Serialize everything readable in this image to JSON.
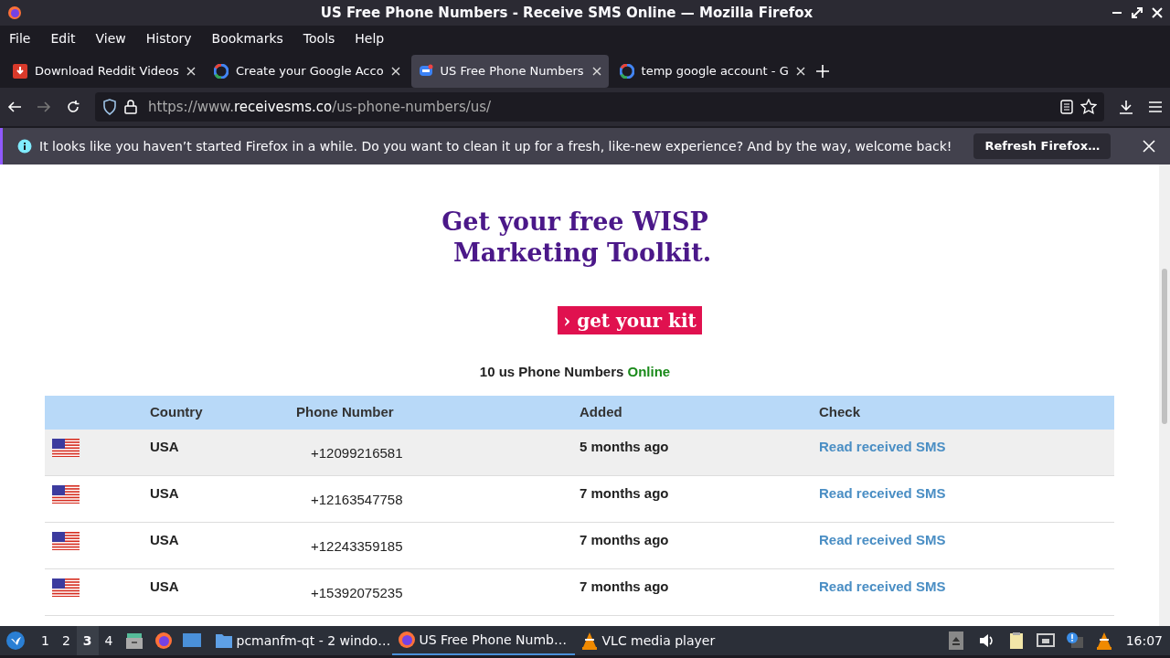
{
  "window": {
    "title": "US Free Phone Numbers - Receive SMS Online — Mozilla Firefox"
  },
  "menu": [
    "File",
    "Edit",
    "View",
    "History",
    "Bookmarks",
    "Tools",
    "Help"
  ],
  "tabs": [
    {
      "label": "Download Reddit Videos",
      "kind": "download",
      "selected": false
    },
    {
      "label": "Create your Google Acco",
      "kind": "google",
      "selected": false
    },
    {
      "label": "US Free Phone Numbers",
      "kind": "chat",
      "selected": true
    },
    {
      "label": "temp google account - G",
      "kind": "google",
      "selected": false
    }
  ],
  "address": {
    "prefix": "https://www.",
    "domain": "receivesms.co",
    "path": "/us-phone-numbers/us/"
  },
  "notification": {
    "message": "It looks like you haven’t started Firefox in a while. Do you want to clean it up for a fresh, like-new experience? And by the way, welcome back!",
    "button": "Refresh Firefox…"
  },
  "ad": {
    "heading_lines": [
      "Get your free WISP",
      "Marketing Toolkit."
    ],
    "button": "get your kit",
    "chevron": "›"
  },
  "summary": {
    "text": "10 us Phone Numbers",
    "status": "Online"
  },
  "table": {
    "columns": [
      "Country",
      "Phone Number",
      "Added",
      "Check"
    ],
    "rows": [
      {
        "country": "USA",
        "number": "+12099216581",
        "added": "5 months ago",
        "link": "Read received SMS",
        "highlighted": true
      },
      {
        "country": "USA",
        "number": "+12163547758",
        "added": "7 months ago",
        "link": "Read received SMS",
        "highlighted": false
      },
      {
        "country": "USA",
        "number": "+12243359185",
        "added": "7 months ago",
        "link": "Read received SMS",
        "highlighted": false
      },
      {
        "country": "USA",
        "number": "+15392075235",
        "added": "7 months ago",
        "link": "Read received SMS",
        "highlighted": false
      }
    ]
  },
  "taskbar": {
    "workspaces": [
      {
        "label": "1",
        "selected": false
      },
      {
        "label": "2",
        "selected": false
      },
      {
        "label": "3",
        "selected": true
      },
      {
        "label": "4",
        "selected": false
      }
    ],
    "windows": [
      {
        "label": "pcmanfm-qt - 2 windo…",
        "kind": "folder",
        "selected": false
      },
      {
        "label": "US Free Phone Numb…",
        "kind": "firefox",
        "selected": true
      },
      {
        "label": "VLC media player",
        "kind": "vlc",
        "selected": false
      }
    ],
    "clock": "16:07"
  }
}
